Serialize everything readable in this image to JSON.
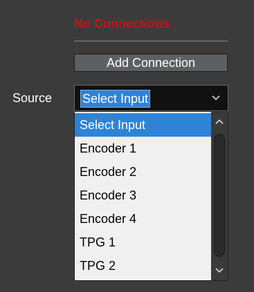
{
  "connections": {
    "status_text": "No Connections",
    "status_color": "#cc1111",
    "add_button_label": "Add Connection"
  },
  "source": {
    "label": "Source",
    "selected_value": "Select Input",
    "options": [
      "Select Input",
      "Encoder 1",
      "Encoder 2",
      "Encoder 3",
      "Encoder 4",
      "TPG 1",
      "TPG 2"
    ],
    "highlighted_index": 0
  },
  "icons": {
    "select_arrow": "chevron-down-icon",
    "scroll_up": "chevron-up-icon",
    "scroll_down": "chevron-down-icon"
  },
  "colors": {
    "background": "#3b3b3b",
    "highlight": "#2f83d6"
  }
}
